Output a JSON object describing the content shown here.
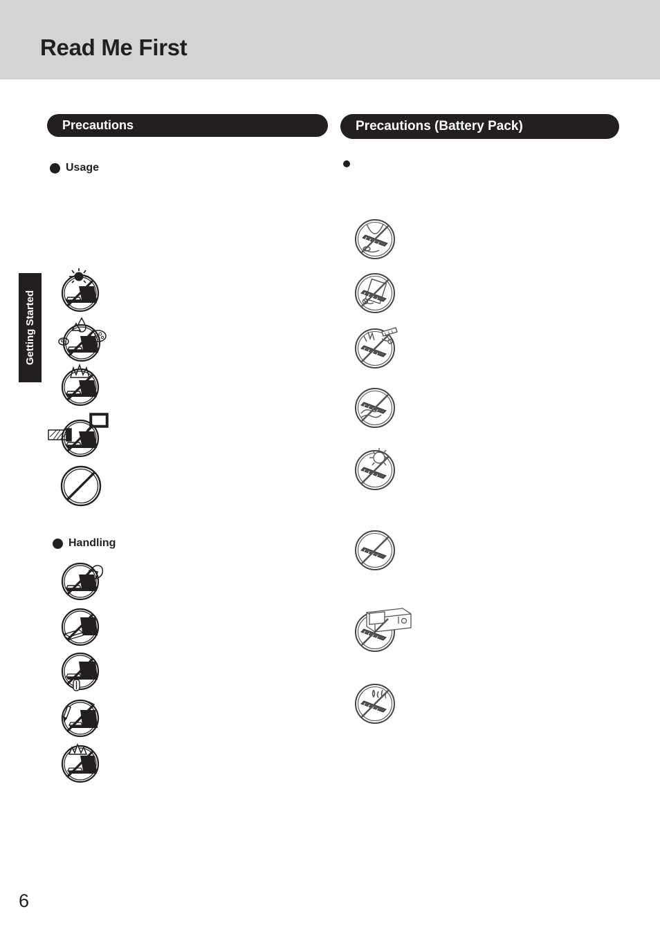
{
  "page": {
    "title": "Read Me First",
    "number": "6",
    "header_bg": "#d3d4d5",
    "ink": "#231f20",
    "paper": "#ffffff"
  },
  "section_tab": {
    "label": "Getting Started"
  },
  "columns": {
    "left": {
      "heading": "Precautions",
      "groups": [
        {
          "label": "Usage",
          "bullet": "filled-circle",
          "icons": [
            {
              "name": "no-direct-sunlight-on-laptop-icon",
              "glyph": "laptop-sun"
            },
            {
              "name": "no-liquids-or-humidity-on-laptop-icon",
              "glyph": "laptop-water"
            },
            {
              "name": "no-high-temperature-near-laptop-icon",
              "glyph": "laptop-flame"
            },
            {
              "name": "no-electronic-interference-near-laptop-icon",
              "glyph": "laptop-devices"
            },
            {
              "name": "general-prohibition-icon",
              "glyph": "plain-slash"
            }
          ]
        },
        {
          "label": "Handling",
          "bullet": "filled-circle",
          "icons": [
            {
              "name": "do-not-carry-laptop-by-display-icon",
              "glyph": "laptop-carry"
            },
            {
              "name": "do-not-place-heavy-objects-on-laptop-icon",
              "glyph": "laptop-books"
            },
            {
              "name": "do-not-insert-objects-into-laptop-icon",
              "glyph": "laptop-insert"
            },
            {
              "name": "do-not-touch-screen-with-sharp-objects-icon",
              "glyph": "laptop-pen"
            },
            {
              "name": "do-not-drop-or-impact-laptop-icon",
              "glyph": "laptop-impact"
            }
          ]
        }
      ]
    },
    "right": {
      "heading": "Precautions (Battery Pack)",
      "groups": [
        {
          "label": "",
          "bullet": "small-filled-circle",
          "icons": [
            {
              "name": "do-not-short-circuit-battery-icon",
              "glyph": "battery-metal"
            },
            {
              "name": "do-not-disassemble-battery-icon",
              "glyph": "battery-tool"
            },
            {
              "name": "do-not-puncture-battery-icon",
              "glyph": "battery-nail"
            },
            {
              "name": "do-not-immerse-battery-in-water-icon",
              "glyph": "battery-water"
            },
            {
              "name": "do-not-expose-battery-to-sunlight-icon",
              "glyph": "battery-sun"
            },
            {
              "name": "do-not-charge-battery-improperly-icon",
              "glyph": "battery-plain"
            },
            {
              "name": "do-not-microwave-battery-icon",
              "glyph": "battery-microwave"
            },
            {
              "name": "do-not-place-battery-near-fire-icon",
              "glyph": "battery-heat"
            }
          ]
        }
      ]
    }
  }
}
